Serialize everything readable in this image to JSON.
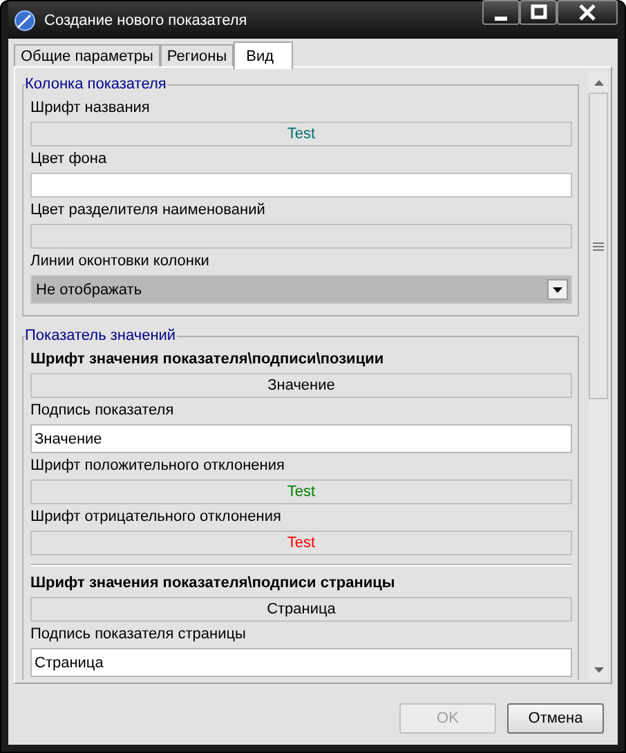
{
  "window": {
    "title": "Создание нового показателя"
  },
  "tabs": [
    {
      "label": "Общие параметры",
      "selected": false
    },
    {
      "label": "Регионы",
      "selected": false
    },
    {
      "label": "Вид",
      "selected": true
    }
  ],
  "sections": [
    {
      "title": "Колонка показателя",
      "fields": [
        {
          "kind": "font",
          "label": "Шрифт названия",
          "bold": false,
          "sample": "Test",
          "color": "#007070"
        },
        {
          "kind": "color",
          "label": "Цвет фона",
          "bold": false,
          "color": "#ffffff"
        },
        {
          "kind": "color",
          "label": "Цвет разделителя наименований",
          "bold": false,
          "color": "#e2e2e2"
        },
        {
          "kind": "select",
          "label": "Линии оконтовки колонки",
          "bold": false,
          "value": "Не отображать"
        }
      ]
    },
    {
      "title": "Показатель значений",
      "fields": [
        {
          "kind": "font",
          "label": "Шрифт значения показателя\\подписи\\позиции",
          "bold": true,
          "sample": "Значение",
          "color": "#000000"
        },
        {
          "kind": "input",
          "label": "Подпись показателя",
          "bold": false,
          "value": "Значение"
        },
        {
          "kind": "font",
          "label": "Шрифт положительного отклонения",
          "bold": false,
          "sample": "Test",
          "color": "#008000"
        },
        {
          "kind": "font",
          "label": "Шрифт отрицательного отклонения",
          "bold": false,
          "sample": "Test",
          "color": "#ff0000"
        },
        {
          "kind": "separator"
        },
        {
          "kind": "font",
          "label": "Шрифт значения показателя\\подписи страницы",
          "bold": true,
          "sample": "Страница",
          "color": "#000000"
        },
        {
          "kind": "input",
          "label": "Подпись показателя страницы",
          "bold": false,
          "value": "Страница"
        }
      ]
    }
  ],
  "buttons": [
    {
      "label": "OK",
      "disabled": true
    },
    {
      "label": "Отмена",
      "disabled": false
    }
  ]
}
